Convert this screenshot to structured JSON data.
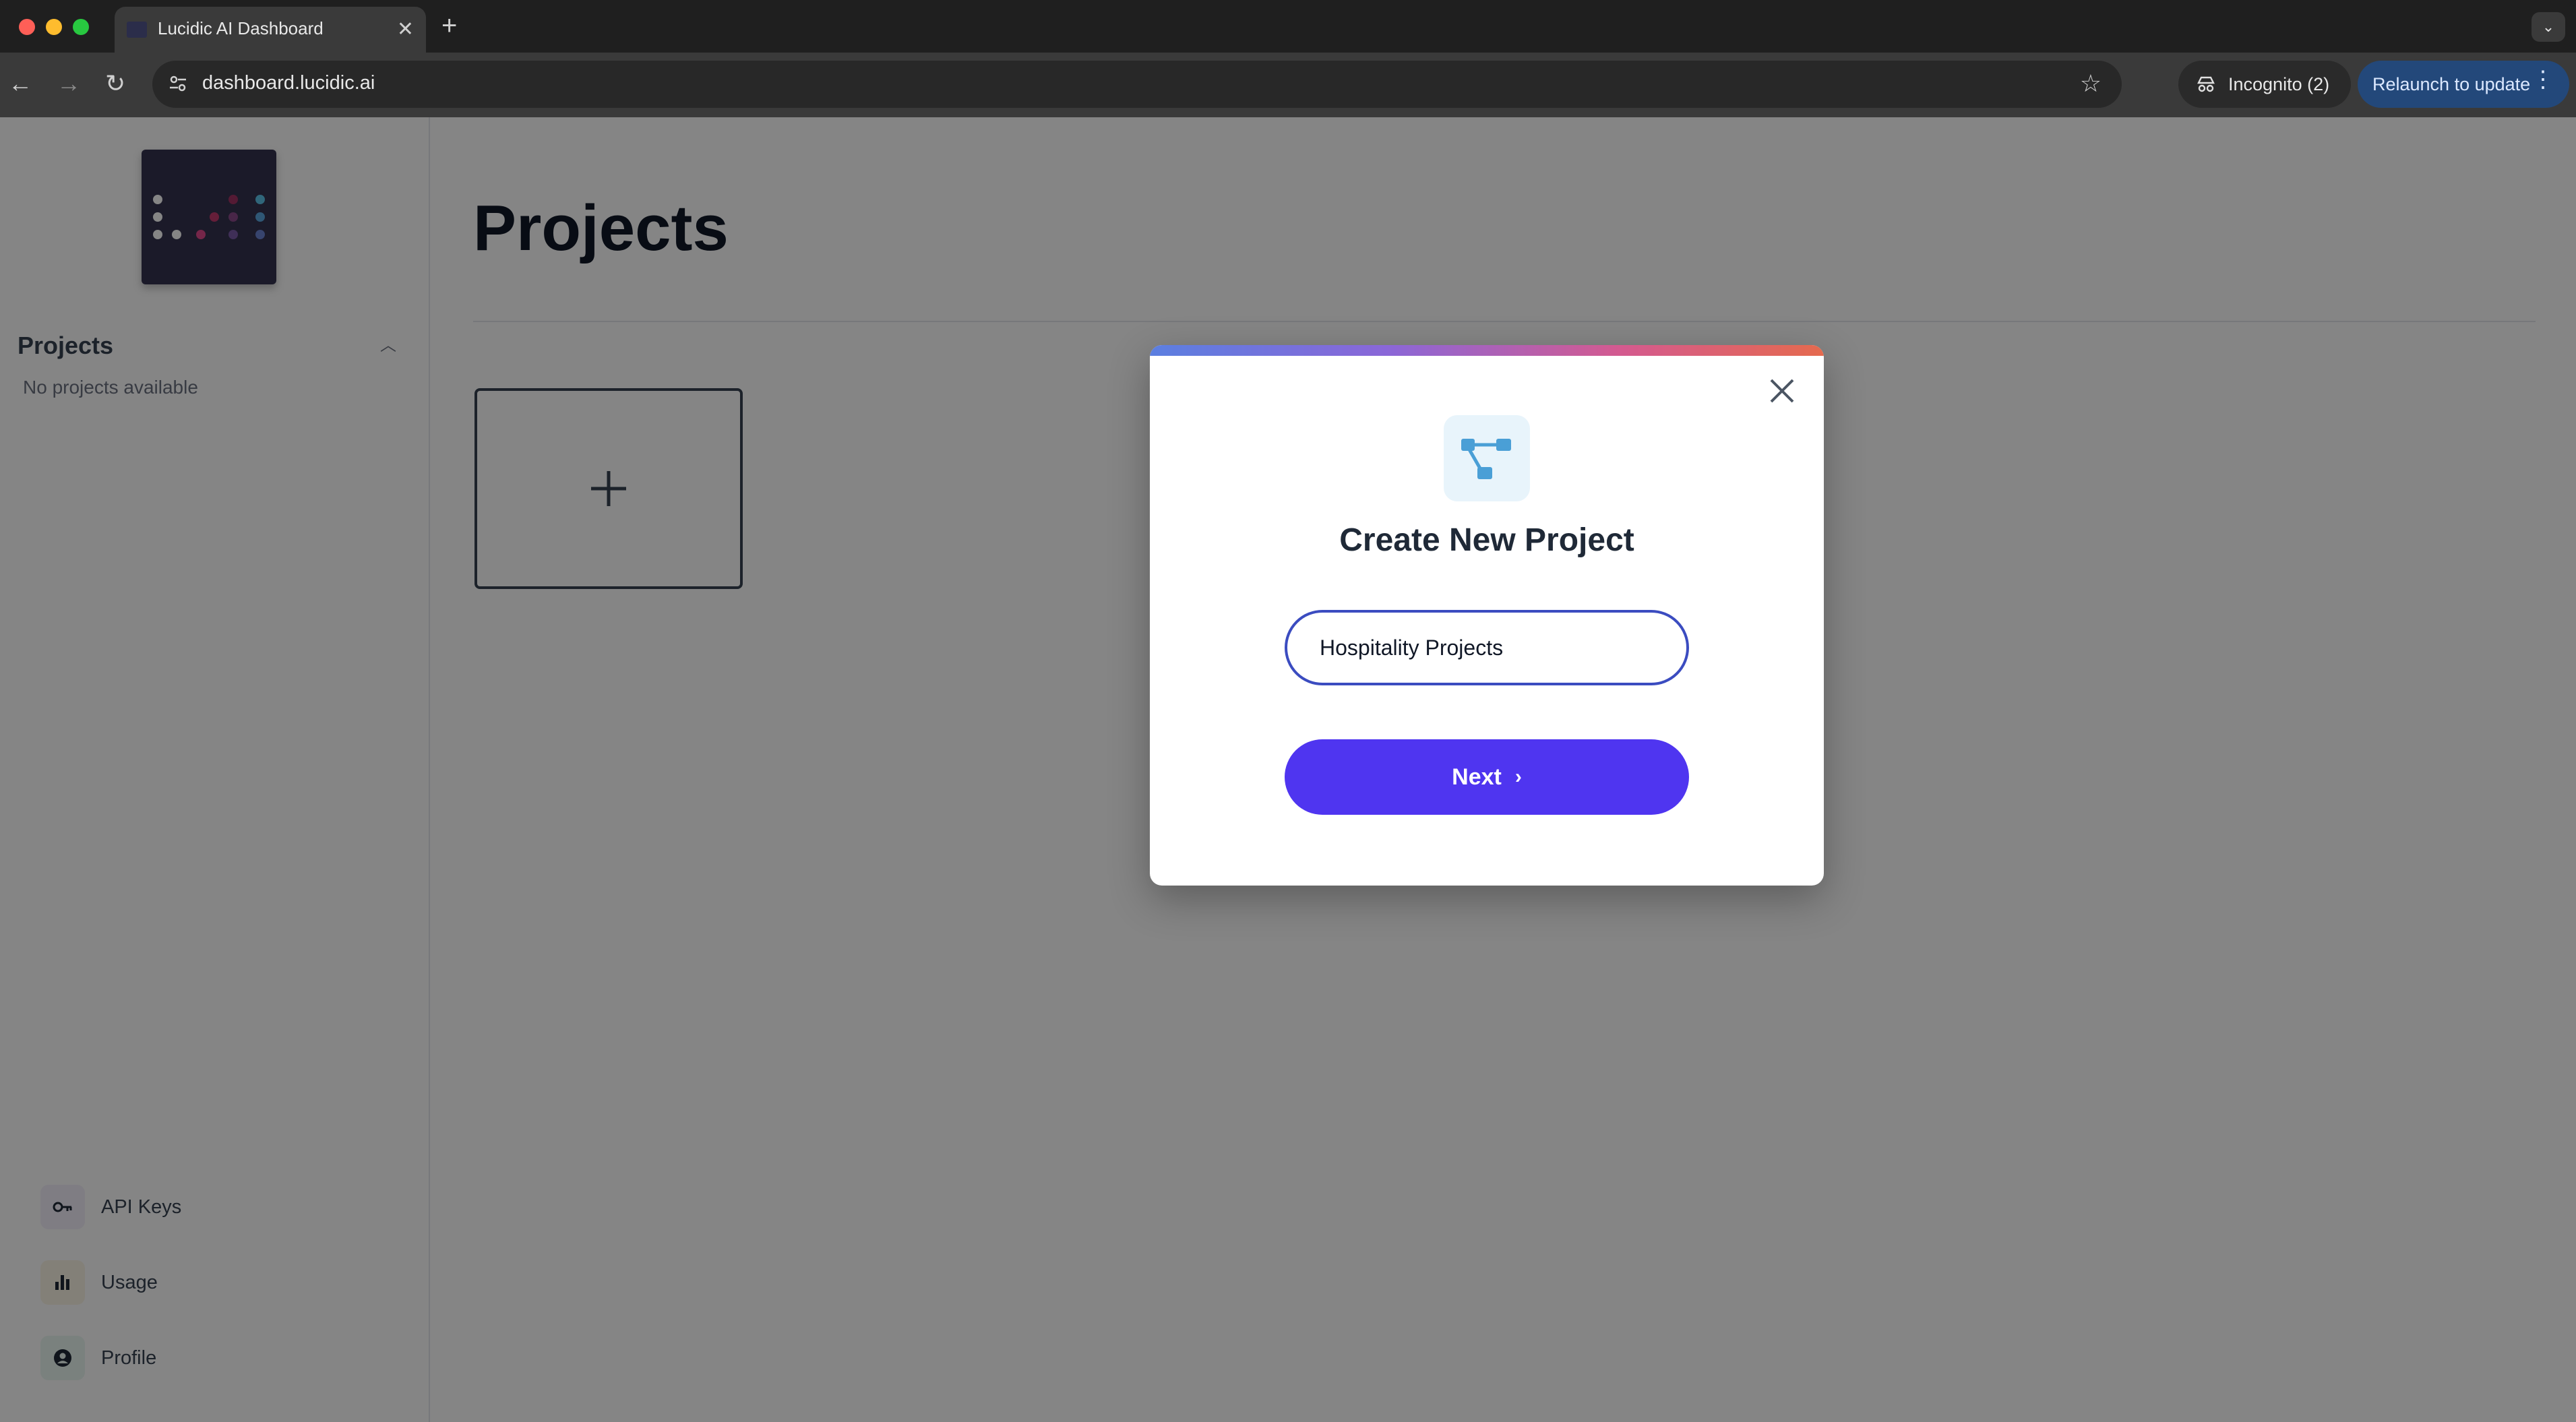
{
  "browser": {
    "tab_title": "Lucidic AI Dashboard",
    "url": "dashboard.lucidic.ai",
    "incognito_label": "Incognito (2)",
    "relaunch_label": "Relaunch to update"
  },
  "sidebar": {
    "projects_heading": "Projects",
    "empty_text": "No projects available",
    "bottom_items": [
      {
        "label": "API Keys",
        "icon": "key-icon",
        "bg": "#f3f0fb"
      },
      {
        "label": "Usage",
        "icon": "bar-chart-icon",
        "bg": "#fbf6e6"
      },
      {
        "label": "Profile",
        "icon": "user-circle-icon",
        "bg": "#eaf7f1"
      }
    ]
  },
  "main": {
    "title": "Projects"
  },
  "modal": {
    "title": "Create New Project",
    "input_value": "Hospitality Projects",
    "next_label": "Next"
  },
  "colors": {
    "primary_button": "#4f35f0",
    "input_border": "#3b4cc0",
    "sidebar_bg": "#ffffff"
  }
}
